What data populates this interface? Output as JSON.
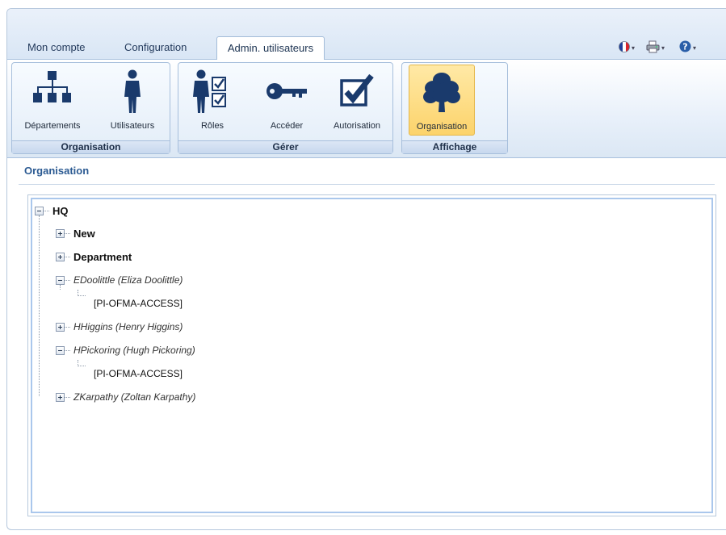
{
  "tabs": [
    {
      "label": "Mon compte"
    },
    {
      "label": "Configuration"
    },
    {
      "label": "Admin. utilisateurs",
      "active": true
    }
  ],
  "quick_access": [
    {
      "icon": "french-flag-icon"
    },
    {
      "icon": "printer-icon"
    },
    {
      "icon": "help-icon"
    }
  ],
  "ribbon": {
    "groups": [
      {
        "label": "Organisation",
        "buttons": [
          {
            "label": "Départements",
            "icon": "departments-org-chart-icon"
          },
          {
            "label": "Utilisateurs",
            "icon": "user-icon"
          }
        ]
      },
      {
        "label": "Gérer",
        "buttons": [
          {
            "label": "Rôles",
            "icon": "user-roles-checklist-icon"
          },
          {
            "label": "Accéder",
            "icon": "key-icon"
          },
          {
            "label": "Autorisation",
            "icon": "checkbox-check-icon"
          }
        ]
      },
      {
        "label": "Affichage",
        "buttons": [
          {
            "label": "Organisation",
            "icon": "tree-icon",
            "selected": true
          }
        ]
      }
    ]
  },
  "colors": {
    "ribbon_icon": "#1a3a6c",
    "selected_button": "#fcd36b",
    "title": "#2b5a92"
  },
  "content": {
    "title": "Organisation",
    "tree": [
      {
        "label": "HQ",
        "style": "bold",
        "expanded": true,
        "level": 0
      },
      {
        "label": "New",
        "style": "bold",
        "expanded": false,
        "level": 1
      },
      {
        "label": "Department",
        "style": "bold",
        "expanded": false,
        "level": 1
      },
      {
        "label": "EDoolittle (Eliza Doolittle)",
        "style": "italic",
        "expanded": true,
        "level": 1
      },
      {
        "label": "[PI-OFMA-ACCESS]",
        "style": "leaf",
        "level": 2
      },
      {
        "label": "HHiggins (Henry Higgins)",
        "style": "italic",
        "expanded": false,
        "level": 1
      },
      {
        "label": "HPickoring (Hugh Pickoring)",
        "style": "italic",
        "expanded": true,
        "level": 1
      },
      {
        "label": "[PI-OFMA-ACCESS]",
        "style": "leaf",
        "level": 2
      },
      {
        "label": "ZKarpathy (Zoltan Karpathy)",
        "style": "italic",
        "expanded": false,
        "level": 1
      }
    ]
  }
}
